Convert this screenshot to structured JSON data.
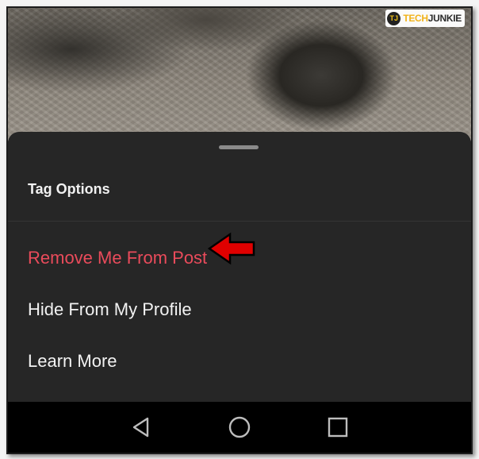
{
  "watermark": {
    "badge": "TJ",
    "text_part1": "TECH",
    "text_part2": "JUNKIE"
  },
  "sheet": {
    "title": "Tag Options",
    "options": [
      {
        "label": "Remove Me From Post",
        "style": "destructive",
        "color": "#ea4b5b"
      },
      {
        "label": "Hide From My Profile",
        "style": "default",
        "color": "#f2f2f2"
      },
      {
        "label": "Learn More",
        "style": "default",
        "color": "#f2f2f2"
      }
    ]
  },
  "annotation": {
    "icon": "red-arrow-icon",
    "color": "#e00000"
  },
  "navbar": {
    "buttons": [
      {
        "icon": "back-triangle-icon"
      },
      {
        "icon": "home-circle-icon"
      },
      {
        "icon": "recents-square-icon"
      }
    ]
  }
}
